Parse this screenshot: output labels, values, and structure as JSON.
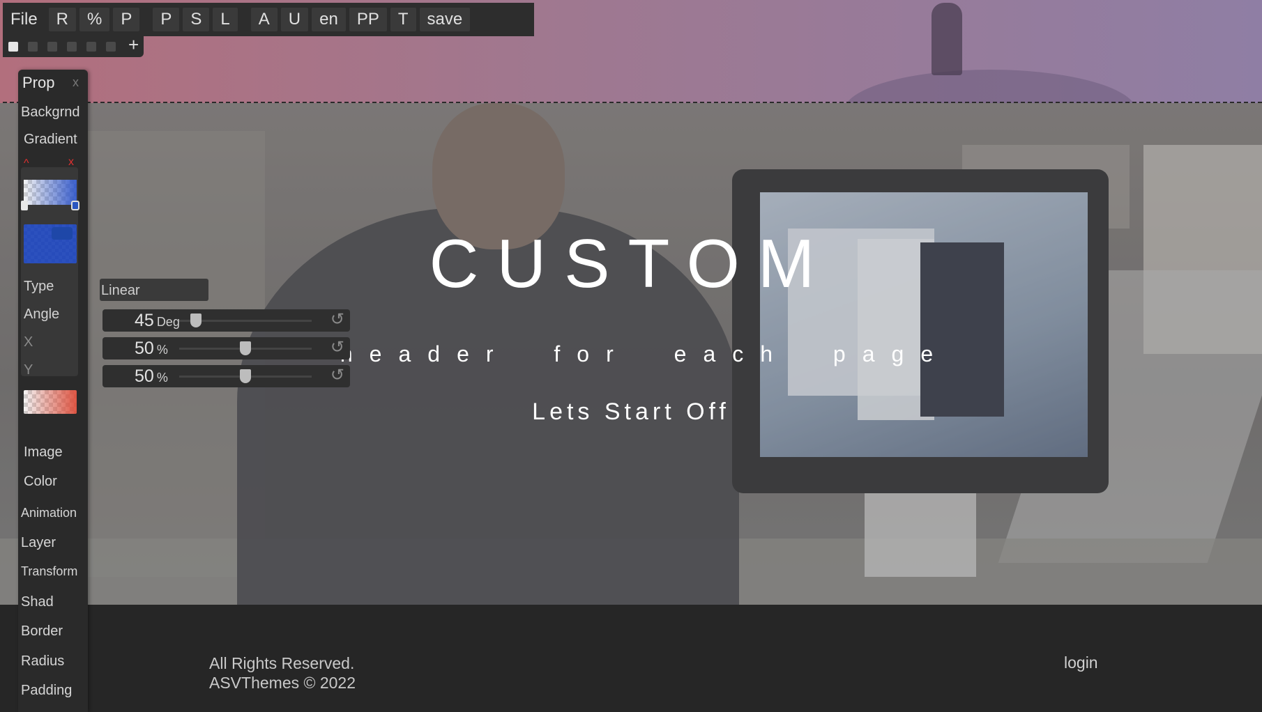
{
  "toolbar": {
    "buttons": [
      "File",
      "R",
      "%",
      "P",
      "P",
      "S",
      "L",
      "A",
      "U",
      "en",
      "PP",
      "T",
      "save"
    ],
    "add_tab": "+"
  },
  "panel": {
    "title": "Prop",
    "close": "x",
    "items": [
      "Backgrnd",
      "Gradient"
    ],
    "gradient_markers": {
      "caret": "^",
      "delete": "x"
    },
    "gradient_labels": [
      "Type",
      "Angle",
      "X",
      "Y"
    ],
    "bottom_items": [
      "Image",
      "Color",
      "Animation",
      "Layer",
      "Transform",
      "Shad",
      "Border",
      "Radius",
      "Padding"
    ]
  },
  "gradient": {
    "type": "Linear",
    "angle": {
      "value": "45",
      "unit": "Deg",
      "min": 0,
      "max": 360
    },
    "x": {
      "value": "50",
      "unit": "%",
      "min": 0,
      "max": 100
    },
    "y": {
      "value": "50",
      "unit": "%",
      "min": 0,
      "max": 100
    },
    "colors": {
      "stop_start": "#e8e8e8",
      "stop_end": "#2a55c0",
      "swatch": "#2a52b8",
      "secondary": "#dc4632"
    }
  },
  "hero": {
    "title": "CUSTOM",
    "subtitle": "header for each page",
    "cta": "Lets Start Off"
  },
  "footer": {
    "rights": "All Rights Reserved.",
    "brand": "ASVThemes © 2022",
    "login": "login"
  }
}
